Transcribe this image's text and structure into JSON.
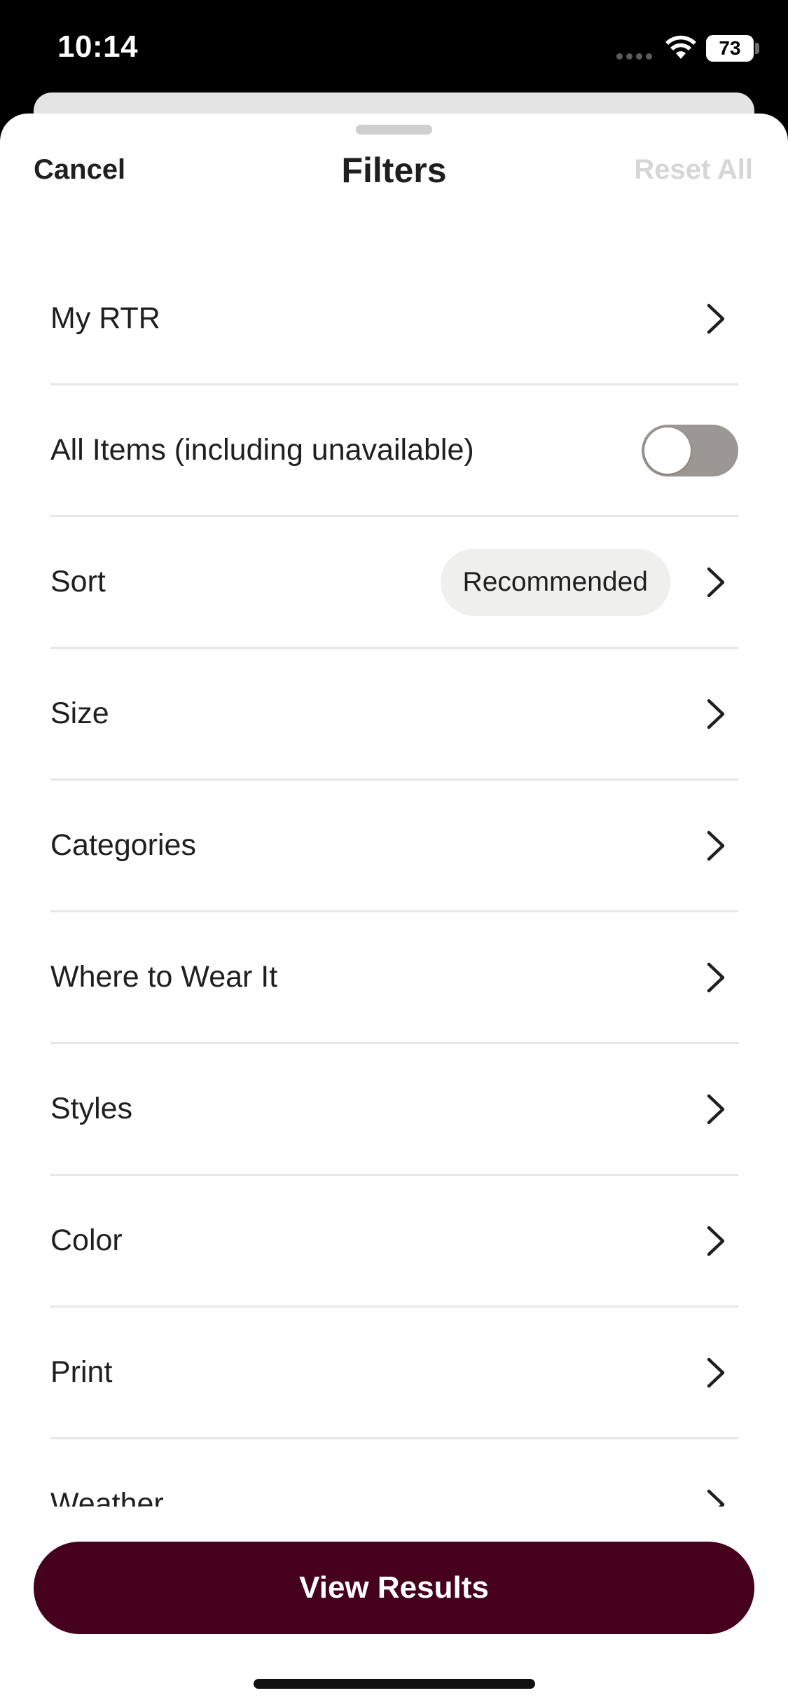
{
  "status_bar": {
    "time": "10:14",
    "battery": "73"
  },
  "header": {
    "cancel_label": "Cancel",
    "title": "Filters",
    "reset_label": "Reset All"
  },
  "filters": [
    {
      "label": "My RTR",
      "control": "chevron"
    },
    {
      "label": "All Items (including unavailable)",
      "control": "toggle",
      "toggle_on": false
    },
    {
      "label": "Sort",
      "control": "chevron",
      "value": "Recommended"
    },
    {
      "label": "Size",
      "control": "chevron"
    },
    {
      "label": "Categories",
      "control": "chevron"
    },
    {
      "label": "Where to Wear It",
      "control": "chevron"
    },
    {
      "label": "Styles",
      "control": "chevron"
    },
    {
      "label": "Color",
      "control": "chevron"
    },
    {
      "label": "Print",
      "control": "chevron"
    },
    {
      "label": "Weather",
      "control": "chevron"
    }
  ],
  "footer": {
    "view_results_label": "View Results"
  },
  "colors": {
    "primary_button": "#45001c",
    "toggle_off": "#9b9792",
    "pill_bg": "#efefed",
    "reset_disabled": "#d6d6d6"
  },
  "icons": {
    "row_chevron": "chevron-right-icon",
    "wifi": "wifi-icon",
    "battery": "battery-icon"
  }
}
